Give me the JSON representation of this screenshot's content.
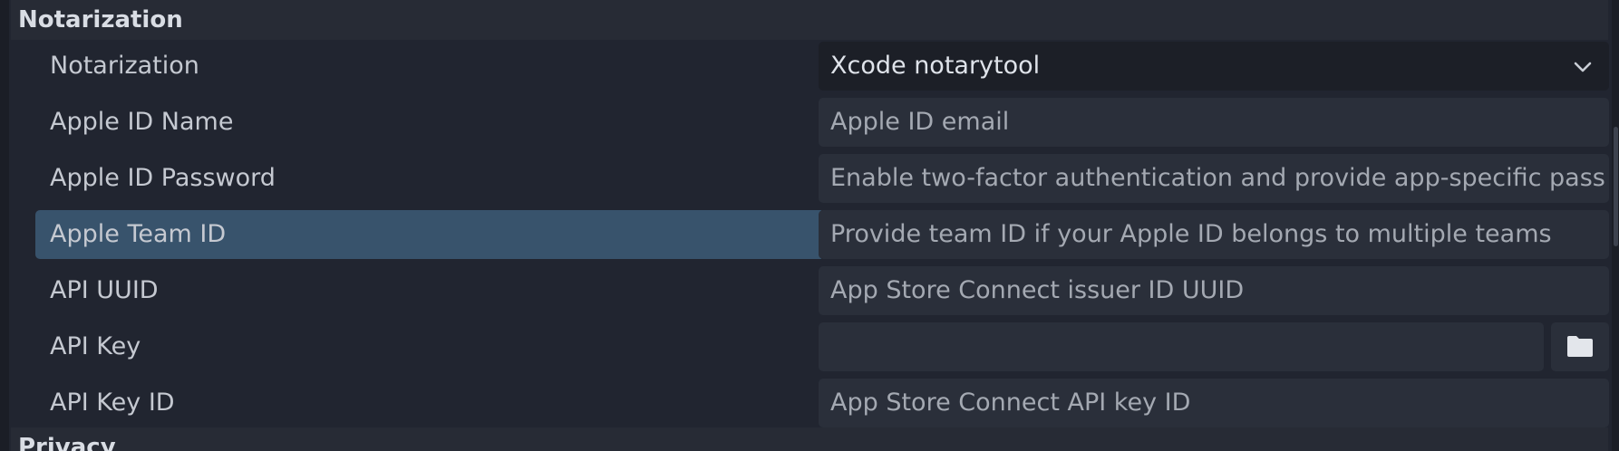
{
  "sections": {
    "notarization_header": "Notarization",
    "privacy_header": "Privacy"
  },
  "rows": {
    "notarization": {
      "label": "Notarization",
      "value": "Xcode notarytool"
    },
    "apple_id_name": {
      "label": "Apple ID Name",
      "placeholder": "Apple ID email"
    },
    "apple_id_password": {
      "label": "Apple ID Password",
      "placeholder": "Enable two-factor authentication and provide app-specific pass"
    },
    "apple_team_id": {
      "label": "Apple Team ID",
      "placeholder": "Provide team ID if your Apple ID belongs to multiple teams"
    },
    "api_uuid": {
      "label": "API UUID",
      "placeholder": "App Store Connect issuer ID UUID"
    },
    "api_key": {
      "label": "API Key",
      "value": ""
    },
    "api_key_id": {
      "label": "API Key ID",
      "placeholder": "App Store Connect API key ID"
    }
  },
  "icons": {
    "dropdown": "chevron-down-icon",
    "file_picker": "folder-icon"
  },
  "colors": {
    "background": "#212530",
    "selected_row": "#38536c",
    "field_background": "#2a2f3a"
  }
}
